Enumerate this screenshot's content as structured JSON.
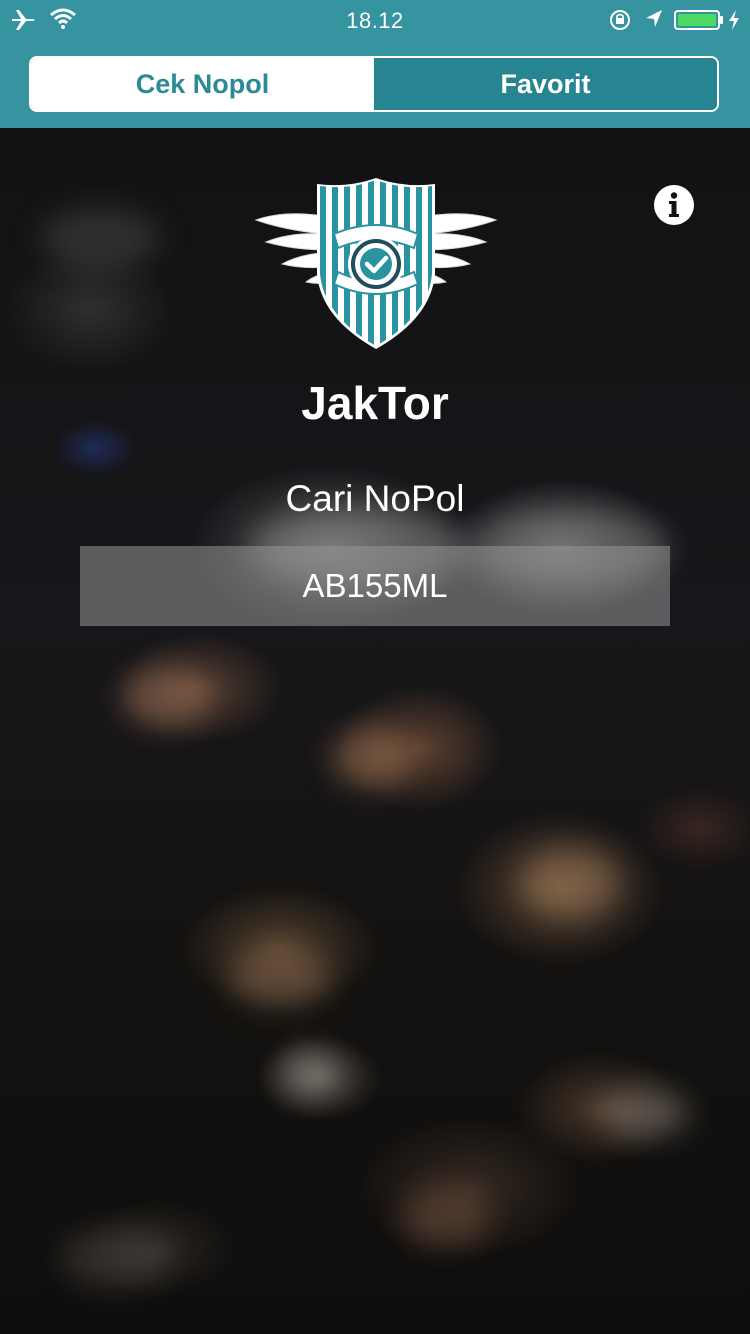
{
  "status_bar": {
    "time": "18.12",
    "icons": [
      "airplane-icon",
      "wifi-icon",
      "rotation-lock-icon",
      "location-icon",
      "battery-icon",
      "charging-icon"
    ]
  },
  "segmented_control": {
    "tabs": [
      {
        "label": "Cek Nopol",
        "selected": true
      },
      {
        "label": "Favorit",
        "selected": false
      }
    ]
  },
  "colors": {
    "header": "#35949f",
    "accent": "#268591",
    "active_text": "#2b8a95",
    "input_bg": "rgba(150,150,150,0.55)"
  },
  "main": {
    "app_title": "JakTor",
    "search_label": "Cari NoPol",
    "plate_input": {
      "value": "AB155ML",
      "placeholder": ""
    },
    "info_icon": "info-icon",
    "logo_icon": "winged-shield-logo"
  }
}
